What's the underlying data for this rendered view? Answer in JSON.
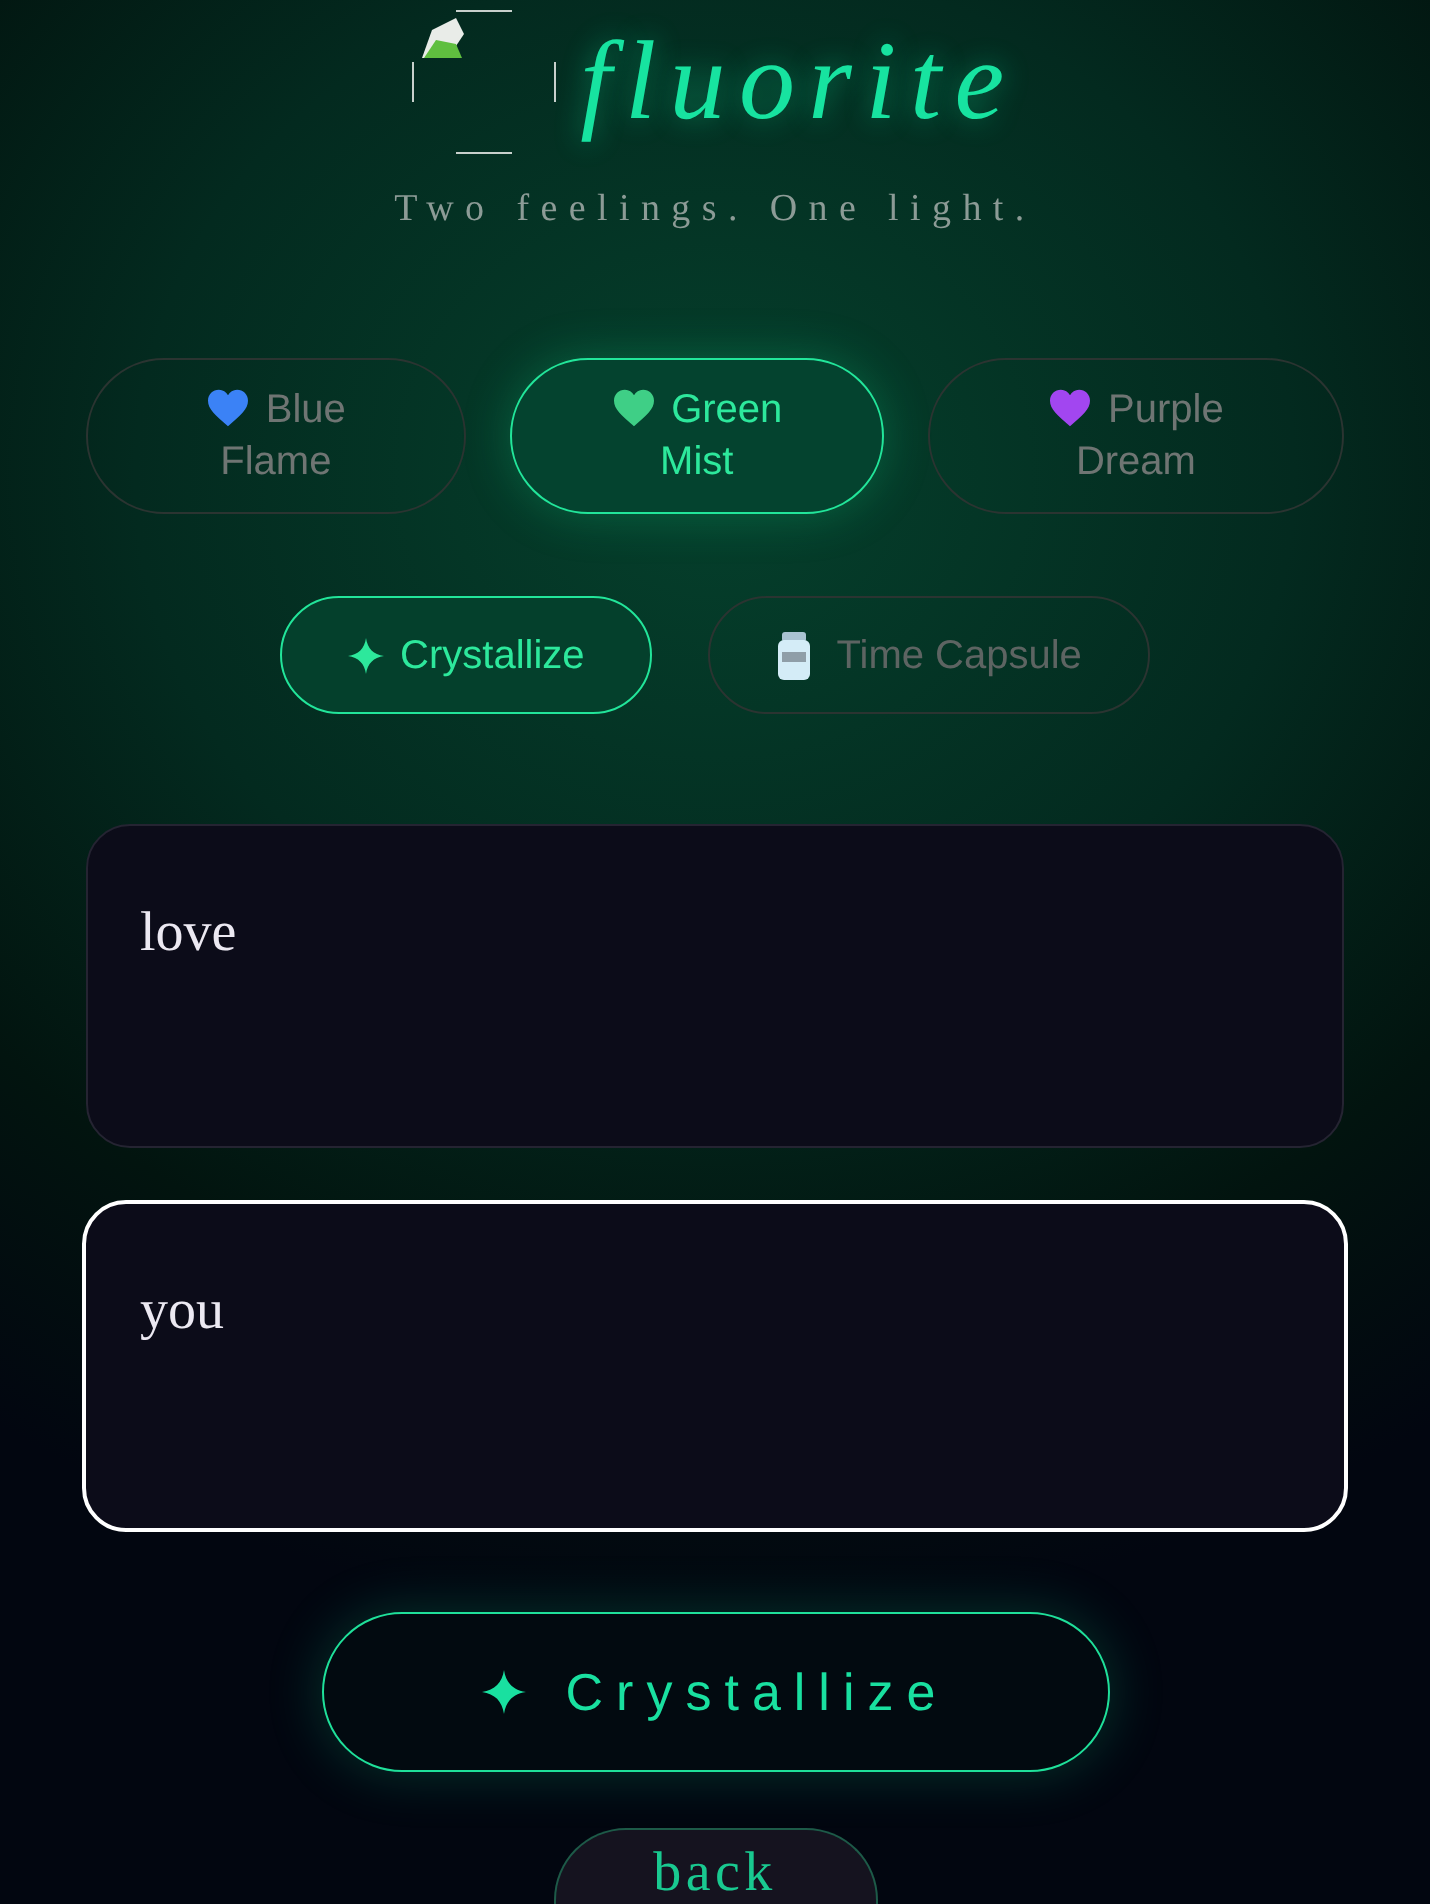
{
  "header": {
    "title": "fluorite",
    "tagline": "Two feelings. One light."
  },
  "themes": [
    {
      "label": "Blue Flame",
      "color": "#3b82f6",
      "selected": false
    },
    {
      "label": "Green Mist",
      "color": "#3fcf86",
      "selected": true
    },
    {
      "label": "Purple Dream",
      "color": "#a246f0",
      "selected": false
    }
  ],
  "modes": [
    {
      "label": "Crystallize",
      "selected": true
    },
    {
      "label": "Time Capsule",
      "selected": false
    }
  ],
  "fields": [
    {
      "value": "love",
      "focused": false
    },
    {
      "value": "you",
      "focused": true
    }
  ],
  "primary_button": {
    "label": "Crystallize"
  },
  "back_button": {
    "label": "back"
  }
}
